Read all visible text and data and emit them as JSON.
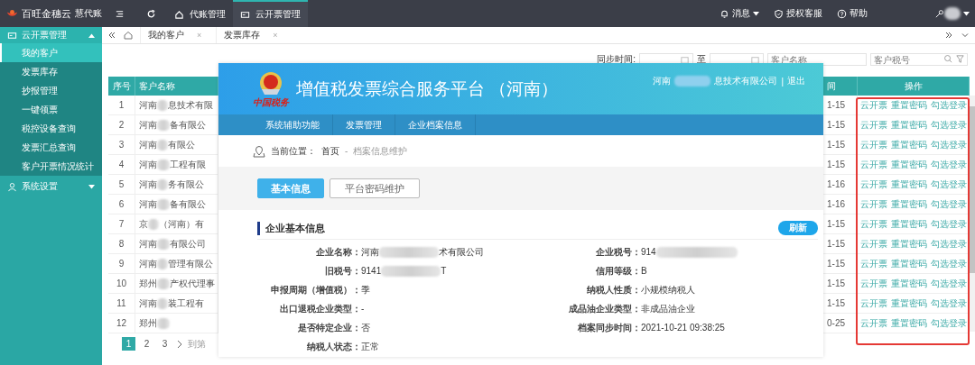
{
  "app": {
    "name": "百旺金穗云",
    "edition": "慧代账"
  },
  "top_nav": [
    {
      "label": "代账管理",
      "selected": false
    },
    {
      "label": "云开票管理",
      "selected": true
    }
  ],
  "top_right": [
    {
      "label": "消息"
    },
    {
      "label": "授权客服"
    },
    {
      "label": "帮助"
    }
  ],
  "sidebar": {
    "groups": [
      {
        "label": "云开票管理",
        "expanded": true,
        "items": [
          {
            "label": "我的客户",
            "selected": true
          },
          {
            "label": "发票库存",
            "selected": false
          },
          {
            "label": "抄报管理",
            "selected": false
          },
          {
            "label": "一键领票",
            "selected": false
          },
          {
            "label": "税控设备查询",
            "selected": false
          },
          {
            "label": "发票汇总查询",
            "selected": false
          },
          {
            "label": "客户开票情况统计",
            "selected": false
          }
        ]
      },
      {
        "label": "系统设置",
        "expanded": false
      }
    ]
  },
  "page_tabs": [
    {
      "label": "我的客户",
      "close": "×"
    },
    {
      "label": "发票库存",
      "close": "×"
    }
  ],
  "filter": {
    "sync_label": "同步时间:",
    "range_sep": "至",
    "name_placeholder": "客户名称",
    "tax_placeholder": "客户税号"
  },
  "table": {
    "columns": [
      "序号",
      "客户名称",
      "间",
      "操作"
    ],
    "rows": [
      {
        "index": "1",
        "name_head": "河南",
        "name_tail": "息技术有限",
        "time": "1-15",
        "actions": [
          "云开票",
          "重置密码",
          "勾选登录"
        ]
      },
      {
        "index": "2",
        "name_head": "河南",
        "name_tail": "备有限公",
        "time": "1-15",
        "actions": [
          "云开票",
          "重置密码",
          "勾选登录"
        ]
      },
      {
        "index": "3",
        "name_head": "河南",
        "name_tail": "有限公",
        "time": "1-15",
        "actions": [
          "云开票",
          "重置密码",
          "勾选登录"
        ]
      },
      {
        "index": "4",
        "name_head": "河南",
        "name_tail": "工程有限",
        "time": "1-15",
        "actions": [
          "云开票",
          "重置密码",
          "勾选登录"
        ]
      },
      {
        "index": "5",
        "name_head": "河南",
        "name_tail": "务有限公",
        "time": "1-16",
        "actions": [
          "云开票",
          "重置密码",
          "勾选登录"
        ]
      },
      {
        "index": "6",
        "name_head": "河南",
        "name_tail": "备有限公",
        "time": "1-16",
        "actions": [
          "云开票",
          "重置密码",
          "勾选登录"
        ]
      },
      {
        "index": "7",
        "name_head": "京",
        "name_tail": "（河南）有",
        "time": "1-15",
        "actions": [
          "云开票",
          "重置密码",
          "勾选登录"
        ]
      },
      {
        "index": "8",
        "name_head": "河南",
        "name_tail": "有限公司",
        "time": "1-15",
        "actions": [
          "云开票",
          "重置密码",
          "勾选登录"
        ]
      },
      {
        "index": "9",
        "name_head": "河南",
        "name_tail": "管理有限公",
        "time": "1-15",
        "actions": [
          "云开票",
          "重置密码",
          "勾选登录"
        ]
      },
      {
        "index": "10",
        "name_head": "郑州",
        "name_tail": "产权代理事",
        "time": "1-15",
        "actions": [
          "云开票",
          "重置密码",
          "勾选登录"
        ]
      },
      {
        "index": "11",
        "name_head": "河南",
        "name_tail": "装工程有",
        "time": "1-15",
        "actions": [
          "云开票",
          "重置密码",
          "勾选登录"
        ]
      },
      {
        "index": "12",
        "name_head": "郑州",
        "time": "0-25",
        "actions": [
          "云开票",
          "重置密码",
          "勾选登录"
        ]
      }
    ]
  },
  "pagination": {
    "pages": [
      {
        "label": "1",
        "selected": true
      },
      {
        "label": "2",
        "selected": false
      },
      {
        "label": "3",
        "selected": false
      }
    ],
    "goto": "到第"
  },
  "overlay": {
    "title": "增值税发票综合服务平台 （河南）",
    "emblem_caption": "中国税务",
    "user_head": "河南",
    "user_tail": "息技术有限公司",
    "separator": "|",
    "logout": "退出",
    "nav": [
      "系统辅助功能",
      "发票管理",
      "企业档案信息"
    ],
    "breadcrumb": {
      "label": "当前位置：",
      "home": "首页",
      "separator": "-",
      "current": "档案信息维护"
    },
    "tabs": [
      {
        "label": "基本信息",
        "selected": true
      },
      {
        "label": "平台密码维护",
        "selected": false
      }
    ],
    "section_title": "企业基本信息",
    "refresh": "刷新",
    "fields": [
      {
        "label": "企业名称：",
        "head": "河南",
        "tail": "术有限公司",
        "redacted": true
      },
      {
        "label": "企业税号：",
        "head": "914",
        "redacted": true
      },
      {
        "label": "旧税号：",
        "head": "9141",
        "tail": "T",
        "redacted": true
      },
      {
        "label": "信用等级：",
        "head": "B",
        "redacted": false
      },
      {
        "label": "申报周期（增值税）：",
        "head": "季",
        "redacted": false
      },
      {
        "label": "纳税人性质：",
        "head": "小规模纳税人",
        "redacted": false
      },
      {
        "label": "出口退税企业类型：",
        "head": "-",
        "redacted": false
      },
      {
        "label": "成品油企业类型：",
        "head": "非成品油企业",
        "redacted": false
      },
      {
        "label": "是否特定企业：",
        "head": "否",
        "redacted": false
      },
      {
        "label": "档案同步时间：",
        "head": "2021-10-21 09:38:25",
        "redacted": false
      },
      {
        "label": "纳税人状态：",
        "head": "正常",
        "redacted": false
      }
    ]
  }
}
